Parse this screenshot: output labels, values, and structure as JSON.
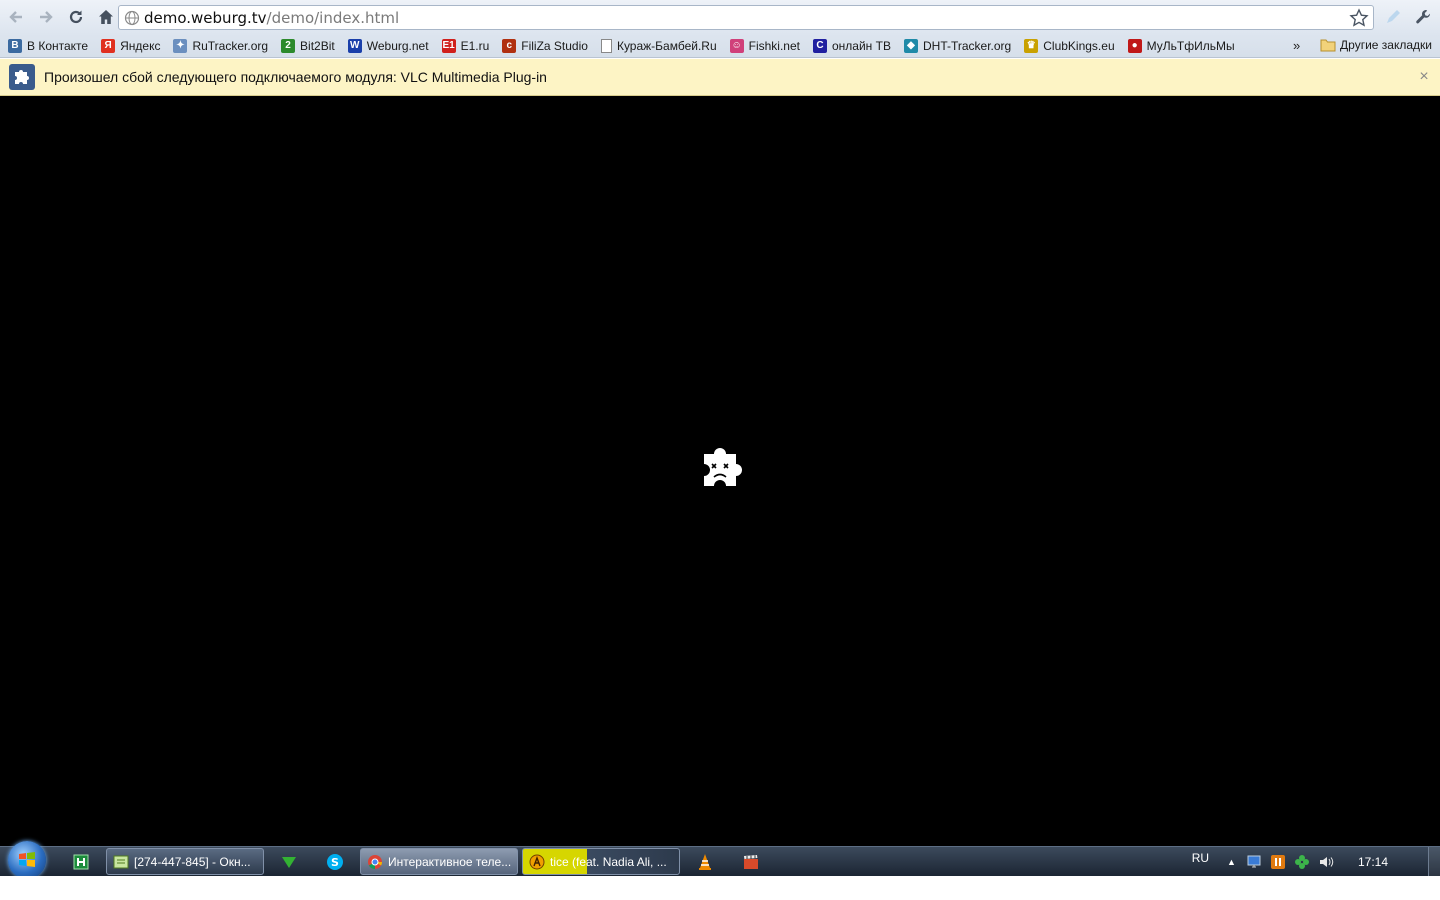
{
  "browser": {
    "url_host": "demo.weburg.tv",
    "url_path": "/demo/index.html"
  },
  "bookmarks": [
    {
      "label": "В Контакте",
      "icon": "vk-icon",
      "color": "#3b6aa0",
      "glyph": "B"
    },
    {
      "label": "Яндекс",
      "icon": "yandex-icon",
      "color": "#e03020",
      "glyph": "Я"
    },
    {
      "label": "RuTracker.org",
      "icon": "rutracker-icon",
      "color": "#6b8fbf",
      "glyph": "✦"
    },
    {
      "label": "Bit2Bit",
      "icon": "bit2bit-icon",
      "color": "#2c8a2c",
      "glyph": "2"
    },
    {
      "label": "Weburg.net",
      "icon": "weburg-icon",
      "color": "#1a3faa",
      "glyph": "W"
    },
    {
      "label": "E1.ru",
      "icon": "e1-icon",
      "color": "#d0201c",
      "glyph": "E1"
    },
    {
      "label": "FiliZa Studio",
      "icon": "filiza-icon",
      "color": "#b03010",
      "glyph": "c"
    },
    {
      "label": "Кураж-Бамбей.Ru",
      "icon": "page-icon",
      "color": "#ffffff",
      "glyph": ""
    },
    {
      "label": "Fishki.net",
      "icon": "fishki-icon",
      "color": "#d0407a",
      "glyph": "☺"
    },
    {
      "label": "онлайн ТВ",
      "icon": "online-tv-icon",
      "color": "#2020a0",
      "glyph": "C"
    },
    {
      "label": "DHT-Tracker.org",
      "icon": "dht-icon",
      "color": "#1f8aa8",
      "glyph": "◆"
    },
    {
      "label": "ClubKings.eu",
      "icon": "clubkings-icon",
      "color": "#c9a100",
      "glyph": "♛"
    },
    {
      "label": "МуЛьТфИльМы",
      "icon": "multfilmy-icon",
      "color": "#c01818",
      "glyph": "●"
    }
  ],
  "bookmarks_more": "»",
  "bookmarks_other": "Другие закладки",
  "infobar": {
    "message": "Произошел сбой следующего подключаемого модуля: VLC Multimedia Plug-in",
    "close": "×"
  },
  "taskbar": {
    "tasks": [
      {
        "label": "[274-447-845] - Окн...",
        "icon": "teamviewer-icon"
      },
      {
        "label": "Интерактивное теле...",
        "icon": "chrome-icon"
      },
      {
        "label": "tice (feat. Nadia Ali, ...",
        "icon": "aimp-icon"
      }
    ],
    "lang": "RU",
    "time": "17:14"
  }
}
